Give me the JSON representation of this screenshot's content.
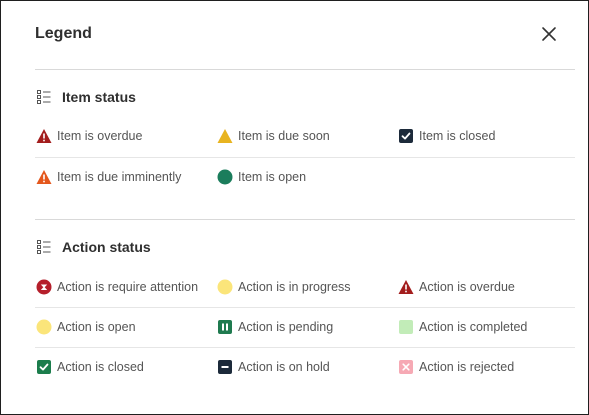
{
  "dialog": {
    "title": "Legend",
    "close_icon": "close-icon"
  },
  "item_status": {
    "heading": "Item status",
    "items": [
      {
        "label": "Item is overdue",
        "icon": "triangle-exclamation-dark-red-icon",
        "color": "#a31d1d"
      },
      {
        "label": "Item is due soon",
        "icon": "triangle-yellow-icon",
        "color": "#e8b420"
      },
      {
        "label": "Item is closed",
        "icon": "checkbox-dark-icon",
        "color": "#1c2a3a"
      },
      {
        "label": "Item is due imminently",
        "icon": "triangle-exclamation-orange-icon",
        "color": "#e4571c"
      },
      {
        "label": "Item is open",
        "icon": "circle-green-icon",
        "color": "#1b7d5c"
      }
    ]
  },
  "action_status": {
    "heading": "Action status",
    "items": [
      {
        "label": "Action is require attention",
        "icon": "circle-exclamation-red-icon",
        "color": "#b51f2b"
      },
      {
        "label": "Action is in progress",
        "icon": "circle-yellow-icon",
        "color": "#fbe57a"
      },
      {
        "label": "Action is overdue",
        "icon": "triangle-exclamation-dark-red-icon",
        "color": "#a31d1d"
      },
      {
        "label": "Action is open",
        "icon": "circle-yellow-icon",
        "color": "#fbe57a"
      },
      {
        "label": "Action is pending",
        "icon": "pause-square-green-icon",
        "color": "#1f7a4f"
      },
      {
        "label": "Action is completed",
        "icon": "square-light-green-icon",
        "color": "#c2ecb8"
      },
      {
        "label": "Action is closed",
        "icon": "checkbox-green-icon",
        "color": "#1b7d4c"
      },
      {
        "label": "Action is on hold",
        "icon": "minus-square-dark-icon",
        "color": "#1c2a3a"
      },
      {
        "label": "Action is rejected",
        "icon": "x-square-pink-icon",
        "color": "#f6a9b4"
      }
    ]
  }
}
